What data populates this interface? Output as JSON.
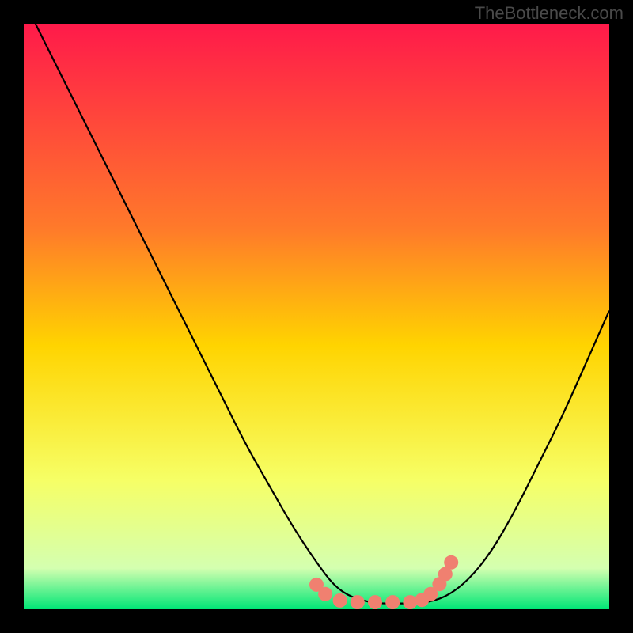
{
  "watermark": "TheBottleneck.com",
  "chart_data": {
    "type": "line",
    "title": "",
    "xlabel": "",
    "ylabel": "",
    "xlim": [
      0,
      100
    ],
    "ylim": [
      0,
      100
    ],
    "gradient_colors": {
      "top": "#ff1a4a",
      "mid1": "#ff7a2a",
      "mid2": "#ffd400",
      "mid3": "#f6ff66",
      "mid4": "#d4ffb0",
      "bottom": "#00e676"
    },
    "series": [
      {
        "name": "bottleneck-curve",
        "x": [
          2,
          6,
          10,
          14,
          18,
          22,
          26,
          30,
          34,
          38,
          42,
          46,
          50,
          53,
          56,
          60,
          64,
          68,
          72,
          76,
          80,
          84,
          88,
          92,
          96,
          100
        ],
        "y": [
          100,
          92,
          84,
          76,
          68,
          60,
          52,
          44,
          36,
          28,
          21,
          14,
          8,
          4,
          2,
          1,
          1,
          1,
          2,
          5,
          10,
          17,
          25,
          33,
          42,
          51
        ]
      }
    ],
    "markers": {
      "name": "highlight-dots",
      "color": "#f08070",
      "points_x": [
        50,
        51.5,
        54,
        57,
        60,
        63,
        66,
        68,
        69.5,
        71,
        72,
        73
      ],
      "points_y": [
        4.2,
        2.6,
        1.5,
        1.2,
        1.2,
        1.2,
        1.2,
        1.6,
        2.6,
        4.3,
        6.0,
        8.0
      ]
    }
  }
}
